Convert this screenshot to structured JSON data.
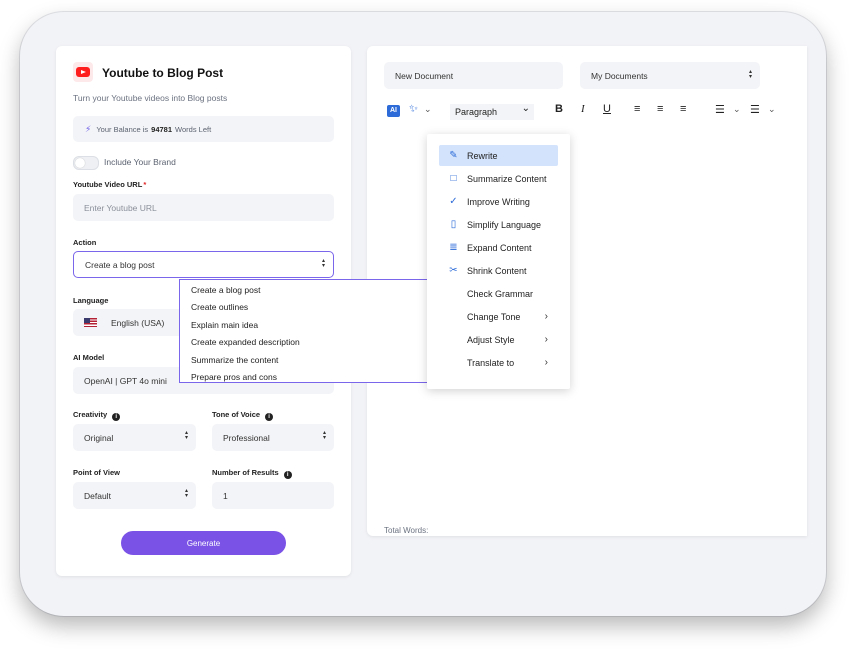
{
  "app": {
    "title": "Youtube to Blog Post",
    "subtitle": "Turn your Youtube videos into Blog posts"
  },
  "balance": {
    "prefix": "Your Balance is",
    "amount": "94781",
    "suffix": "Words Left"
  },
  "brand_toggle": {
    "label": "Include Your Brand",
    "on": false
  },
  "url_field": {
    "label": "Youtube Video URL",
    "required_mark": "*",
    "placeholder": "Enter Youtube URL"
  },
  "action": {
    "label": "Action",
    "selected": "Create a blog post",
    "options": [
      "Create a blog post",
      "Create outlines",
      "Explain main idea",
      "Create expanded description",
      "Summarize the content",
      "Prepare pros and cons"
    ]
  },
  "language": {
    "label": "Language",
    "selected": "English (USA)"
  },
  "ai_model": {
    "label": "AI Model",
    "selected": "OpenAI | GPT 4o mini"
  },
  "creativity": {
    "label": "Creativity",
    "selected": "Original"
  },
  "tone": {
    "label": "Tone of Voice",
    "selected": "Professional"
  },
  "pov": {
    "label": "Point of View",
    "selected": "Default"
  },
  "results": {
    "label": "Number of Results",
    "value": "1"
  },
  "generate_label": "Generate",
  "editor": {
    "doc_name": "New Document",
    "folder": "My Documents",
    "ai_label": "AI",
    "paragraph": "Paragraph",
    "total_words": "Total Words:",
    "ai_menu": [
      {
        "label": "Rewrite",
        "icon": "edit-icon"
      },
      {
        "label": "Summarize Content",
        "icon": "book-icon"
      },
      {
        "label": "Improve Writing",
        "icon": "check-double-icon"
      },
      {
        "label": "Simplify Language",
        "icon": "document-icon"
      },
      {
        "label": "Expand Content",
        "icon": "expand-icon"
      },
      {
        "label": "Shrink Content",
        "icon": "scissors-icon"
      },
      {
        "label": "Check Grammar",
        "icon": ""
      },
      {
        "label": "Change Tone",
        "icon": ""
      },
      {
        "label": "Adjust Style",
        "icon": ""
      },
      {
        "label": "Translate to",
        "icon": ""
      }
    ]
  },
  "colors": {
    "accent": "#7a52e6",
    "highlight": "#d3e3fb",
    "brand_red": "#ff1e1e",
    "ai_blue": "#2c6bd8"
  }
}
